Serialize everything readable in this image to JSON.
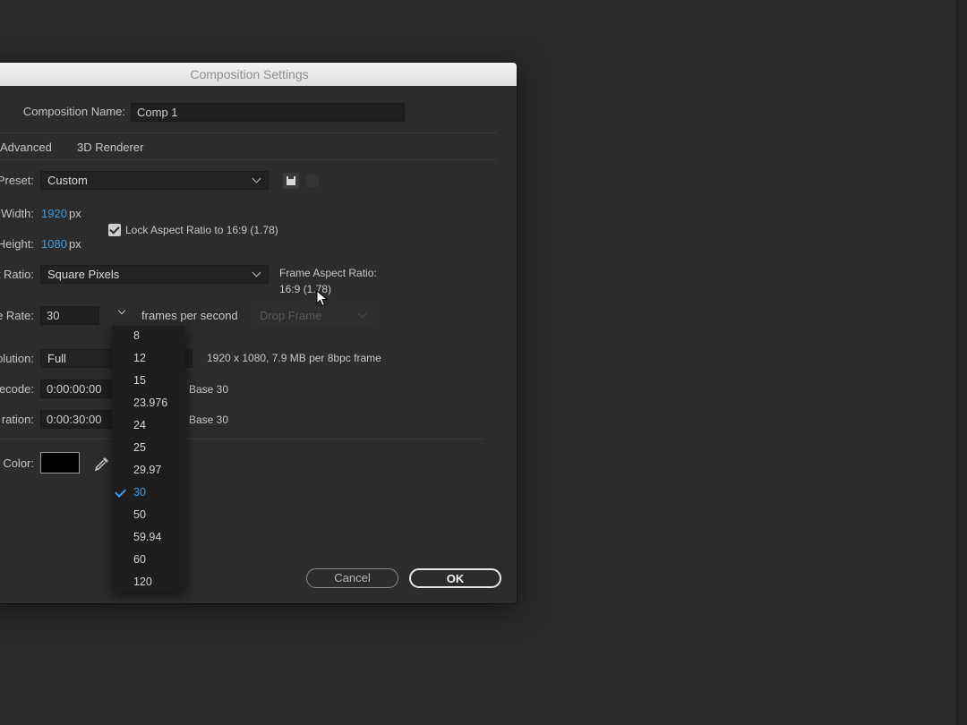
{
  "dialog": {
    "title": "Composition Settings",
    "composition_name_label": "Composition Name:",
    "composition_name_value": "Comp 1",
    "tabs": [
      {
        "label": "Advanced"
      },
      {
        "label": "3D Renderer"
      }
    ],
    "preset": {
      "label": "Preset:",
      "value": "Custom"
    },
    "width": {
      "label": "Width:",
      "value": "1920",
      "unit": "px"
    },
    "height": {
      "label": "Height:",
      "value": "1080",
      "unit": "px"
    },
    "lock_aspect": {
      "label": "Lock Aspect Ratio to 16:9 (1.78)",
      "checked": true
    },
    "pixel_aspect": {
      "label": "t Ratio:",
      "value": "Square Pixels"
    },
    "frame_aspect": {
      "label": "Frame Aspect Ratio:",
      "value": "16:9 (1.78)"
    },
    "frame_rate": {
      "label": "e Rate:",
      "value": "30",
      "unit": "frames per second",
      "drop_frame": "Drop Frame"
    },
    "resolution": {
      "label": "olution:",
      "value": "Full",
      "info": "1920 x 1080, 7.9 MB per 8bpc frame"
    },
    "timecode": {
      "label": "ecode:",
      "value": "0:00:00:00",
      "base": "Base 30"
    },
    "duration": {
      "label": "ration:",
      "value": "0:00:30:00",
      "base": "Base 30"
    },
    "bg_color": {
      "label": "l Color:",
      "swatch": "#000000"
    },
    "buttons": {
      "cancel": "Cancel",
      "ok": "OK"
    }
  },
  "frame_rate_menu": {
    "items": [
      "8",
      "12",
      "15",
      "23.976",
      "24",
      "25",
      "29.97",
      "30",
      "50",
      "59.94",
      "60",
      "120"
    ],
    "selected": "30"
  },
  "colors": {
    "accent": "#3d9ce8",
    "background": "#2a2a2a",
    "dialog": "#2c2c2c"
  }
}
